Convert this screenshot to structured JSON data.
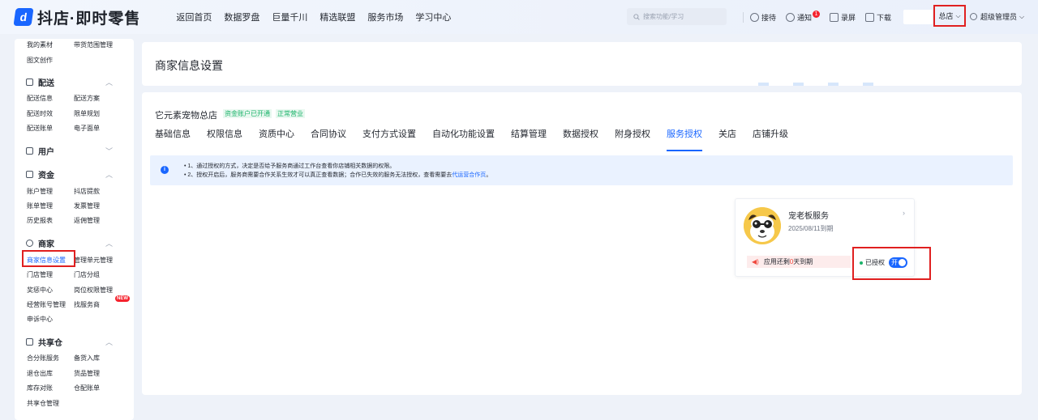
{
  "app": {
    "logo_text": "抖店·即时零售",
    "logo_mark": "d"
  },
  "topnav": [
    "返回首页",
    "数据罗盘",
    "巨量千川",
    "精选联盟",
    "服务市场",
    "学习中心"
  ],
  "search": {
    "placeholder": "搜索功能/学习"
  },
  "toolbar": {
    "reception": "接待",
    "notify": "通知",
    "notify_count": "1",
    "record": "录屏",
    "download": "下载",
    "store_selector": "总店",
    "admin": "超级管理员"
  },
  "sidebar": {
    "top_rows": [
      [
        "我的素材",
        "带货范围管理"
      ],
      [
        "图文创作",
        ""
      ]
    ],
    "delivery": {
      "title": "配送",
      "rows": [
        [
          "配送信息",
          "配送方案"
        ],
        [
          "配送时效",
          "限单规划"
        ],
        [
          "配送账单",
          "电子面单"
        ]
      ]
    },
    "user": {
      "title": "用户"
    },
    "funds": {
      "title": "资金",
      "rows": [
        [
          "账户管理",
          "抖店提款"
        ],
        [
          "账单管理",
          "发票管理"
        ],
        [
          "历史报表",
          "返佣管理"
        ]
      ]
    },
    "merchant": {
      "title": "商家",
      "rows": [
        [
          "商家信息设置",
          "管理单元管理"
        ],
        [
          "门店管理",
          "门店分组"
        ],
        [
          "奖惩中心",
          "岗位权限管理"
        ],
        [
          "经营账号管理",
          "找服务商"
        ],
        [
          "申诉中心",
          ""
        ]
      ],
      "new_badge": "NEW"
    },
    "warehouse": {
      "title": "共享仓",
      "rows": [
        [
          "合分账服务",
          "备货入库"
        ],
        [
          "退仓出库",
          "货品管理"
        ],
        [
          "库存对账",
          "仓配账单"
        ],
        [
          "共享仓管理",
          ""
        ]
      ]
    }
  },
  "header": {
    "title": "商家信息设置"
  },
  "main": {
    "store_name": "它元素宠物总店",
    "tags": [
      "资金账户已开通",
      "正常营业"
    ],
    "tabs": [
      "基础信息",
      "权限信息",
      "资质中心",
      "合同协议",
      "支付方式设置",
      "自动化功能设置",
      "结算管理",
      "数据授权",
      "附身授权",
      "服务授权",
      "关店",
      "店铺升级"
    ],
    "active_tab": "服务授权",
    "notice": {
      "line1": "1、通过授权的方式，决定是否给予服务商通过工作台查看你店铺相关数据的权限。",
      "line2_prefix": "2、授权开启后，服务商需要合作关系生效才可以真正查看数据；合作已失效的服务无法授权，查看需要去",
      "line2_link": "代运营合作页",
      "line2_suffix": "。"
    },
    "service_card": {
      "name": "宠老板服务",
      "expire_date": "2025/08/11到期",
      "expire_prefix": "应用还剩",
      "expire_days": "0",
      "expire_suffix": "天到期",
      "auth_status": "已授权",
      "toggle_label": "开"
    }
  }
}
